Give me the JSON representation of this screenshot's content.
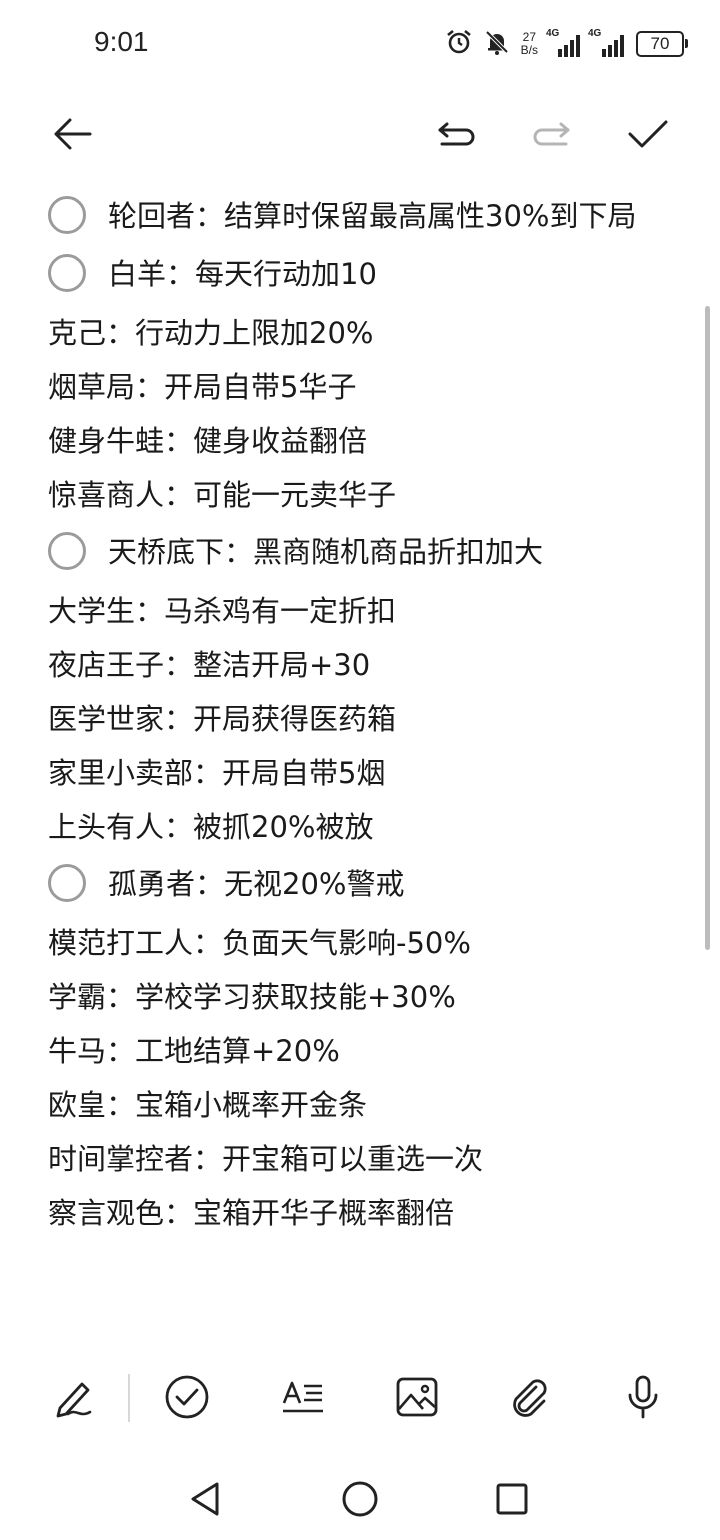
{
  "status_bar": {
    "time": "9:01",
    "net_speed_value": "27",
    "net_speed_unit": "B/s",
    "signal1_label": "4G",
    "signal2_label": "4G",
    "battery": "70",
    "icons": [
      "alarm-icon",
      "mute-bell-icon",
      "signal-icon",
      "signal-icon",
      "battery-icon"
    ]
  },
  "toolbar": {
    "icons": [
      "back-arrow-icon",
      "undo-icon",
      "redo-icon",
      "check-icon"
    ]
  },
  "note": {
    "lines": [
      {
        "type": "todo",
        "text": "轮回者：结算时保留最高属性30%到下局"
      },
      {
        "type": "todo",
        "text": "白羊：每天行动加10"
      },
      {
        "type": "text",
        "text": "克己：行动力上限加20%"
      },
      {
        "type": "text",
        "text": "烟草局：开局自带5华子"
      },
      {
        "type": "text",
        "text": "健身牛蛙：健身收益翻倍"
      },
      {
        "type": "text",
        "text": "惊喜商人：可能一元卖华子"
      },
      {
        "type": "todo",
        "text": "天桥底下：黑商随机商品折扣加大"
      },
      {
        "type": "text",
        "text": "大学生：马杀鸡有一定折扣"
      },
      {
        "type": "text",
        "text": "夜店王子：整洁开局+30"
      },
      {
        "type": "text",
        "text": "医学世家：开局获得医药箱"
      },
      {
        "type": "text",
        "text": "家里小卖部：开局自带5烟"
      },
      {
        "type": "text",
        "text": "上头有人：被抓20%被放"
      },
      {
        "type": "todo",
        "text": "孤勇者：无视20%警戒"
      },
      {
        "type": "text",
        "text": "模范打工人：负面天气影响-50%"
      },
      {
        "type": "text",
        "text": "学霸：学校学习获取技能+30%"
      },
      {
        "type": "text",
        "text": "牛马：工地结算+20%"
      },
      {
        "type": "text",
        "text": "欧皇：宝箱小概率开金条"
      },
      {
        "type": "text",
        "text": "时间掌控者：开宝箱可以重选一次"
      },
      {
        "type": "text",
        "text": "察言观色：宝箱开华子概率翻倍"
      }
    ]
  },
  "bottom_tools": {
    "icons": [
      "pen-icon",
      "checklist-icon",
      "text-format-icon",
      "image-icon",
      "attachment-icon",
      "microphone-icon"
    ]
  },
  "navbar": {
    "icons": [
      "nav-back-icon",
      "nav-home-icon",
      "nav-recents-icon"
    ]
  },
  "colors": {
    "text": "#1a1a1a",
    "circle": "#9b9b9b",
    "disabled": "#b5b5b5"
  }
}
